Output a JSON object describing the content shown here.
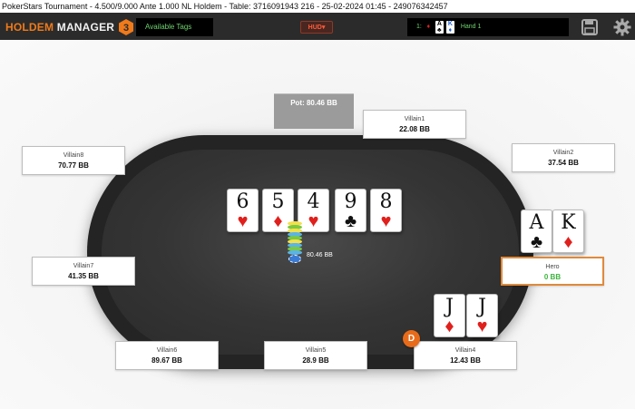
{
  "window": {
    "title": "PokerStars Tournament - 4.500/9.000 Ante 1.000 NL Holdem - Table: 3716091943 216 - 25-02-2024 01:45 - 249076342457"
  },
  "toolbar": {
    "logo_text_a": "HOLDEM",
    "logo_text_b": "MANAGER",
    "logo_badge": "3",
    "tags_label": "Available Tags",
    "hud_label": "HUD",
    "hand_number": "1:",
    "hand_label": "Hand 1",
    "save_icon": "save-icon",
    "settings_icon": "gear-icon"
  },
  "hand_cards": [
    {
      "rank": "",
      "suit": "♦",
      "color": "#e0201c"
    },
    {
      "rank": "A",
      "suit": "♣",
      "color": "#111111"
    },
    {
      "rank": "K",
      "suit": "♦",
      "color": "#1f5fd6"
    }
  ],
  "pot": {
    "label": "Pot: 80.46 BB",
    "chip_label": "80.46 BB"
  },
  "board": [
    {
      "rank": "6",
      "suit": "♥",
      "color": "red"
    },
    {
      "rank": "5",
      "suit": "♦",
      "color": "red"
    },
    {
      "rank": "4",
      "suit": "♥",
      "color": "red"
    },
    {
      "rank": "9",
      "suit": "♣",
      "color": "black"
    },
    {
      "rank": "8",
      "suit": "♥",
      "color": "red"
    }
  ],
  "seats": [
    {
      "name": "Villain1",
      "stack": "22.08 BB"
    },
    {
      "name": "Villain2",
      "stack": "37.54 BB"
    },
    {
      "name": "Hero",
      "stack": "0 BB"
    },
    {
      "name": "Villain4",
      "stack": "12.43 BB"
    },
    {
      "name": "Villain5",
      "stack": "28.9 BB"
    },
    {
      "name": "Villain6",
      "stack": "89.67 BB"
    },
    {
      "name": "Villain7",
      "stack": "41.35 BB"
    },
    {
      "name": "Villain8",
      "stack": "70.77 BB"
    }
  ],
  "hero_cards": [
    {
      "rank": "A",
      "suit": "♣",
      "color": "black"
    },
    {
      "rank": "K",
      "suit": "♦",
      "color": "red"
    }
  ],
  "villain4_cards": [
    {
      "rank": "J",
      "suit": "♦",
      "color": "red"
    },
    {
      "rank": "J",
      "suit": "♥",
      "color": "red"
    }
  ],
  "dealer_label": "D"
}
